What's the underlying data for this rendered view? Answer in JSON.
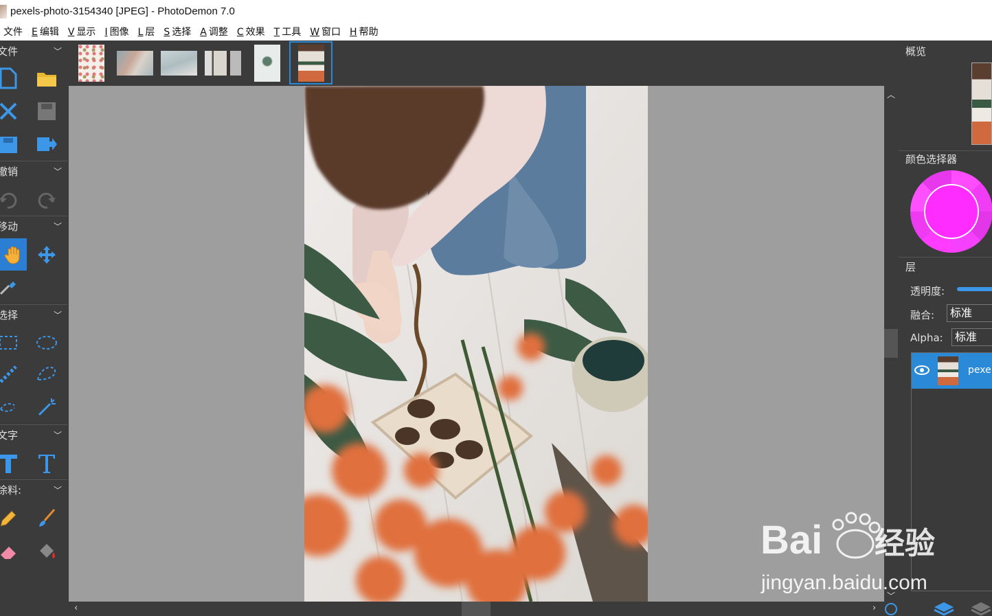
{
  "window": {
    "title": "pexels-photo-3154340 [JPEG]  -  PhotoDemon 7.0"
  },
  "menu": [
    {
      "label": "文件",
      "key": ""
    },
    {
      "label": "编辑",
      "key": "E"
    },
    {
      "label": "显示",
      "key": "V"
    },
    {
      "label": "图像",
      "key": "I"
    },
    {
      "label": "层",
      "key": "L"
    },
    {
      "label": "选择",
      "key": "S"
    },
    {
      "label": "调整",
      "key": "A"
    },
    {
      "label": "效果",
      "key": "C"
    },
    {
      "label": "工具",
      "key": "T"
    },
    {
      "label": "窗口",
      "key": "W"
    },
    {
      "label": "帮助",
      "key": "H"
    }
  ],
  "toolbox": {
    "sections": [
      "文件",
      "撤销",
      "移动",
      "选择",
      "文字",
      "涂料:"
    ]
  },
  "right_panel": {
    "overview": "概览",
    "color_selector": "颜色选择器",
    "layers": "层",
    "opacity_label": "透明度:",
    "blend_label": "融合:",
    "blend_value": "标准",
    "alpha_label": "Alpha:",
    "alpha_value": "标准",
    "layer_name": "pexel"
  },
  "colors": {
    "accent": "#2a7fd4",
    "selected_color": "#ff2cff"
  },
  "watermark": {
    "brand": "Bai",
    "brand2": "经验",
    "url": "jingyan.baidu.com"
  }
}
